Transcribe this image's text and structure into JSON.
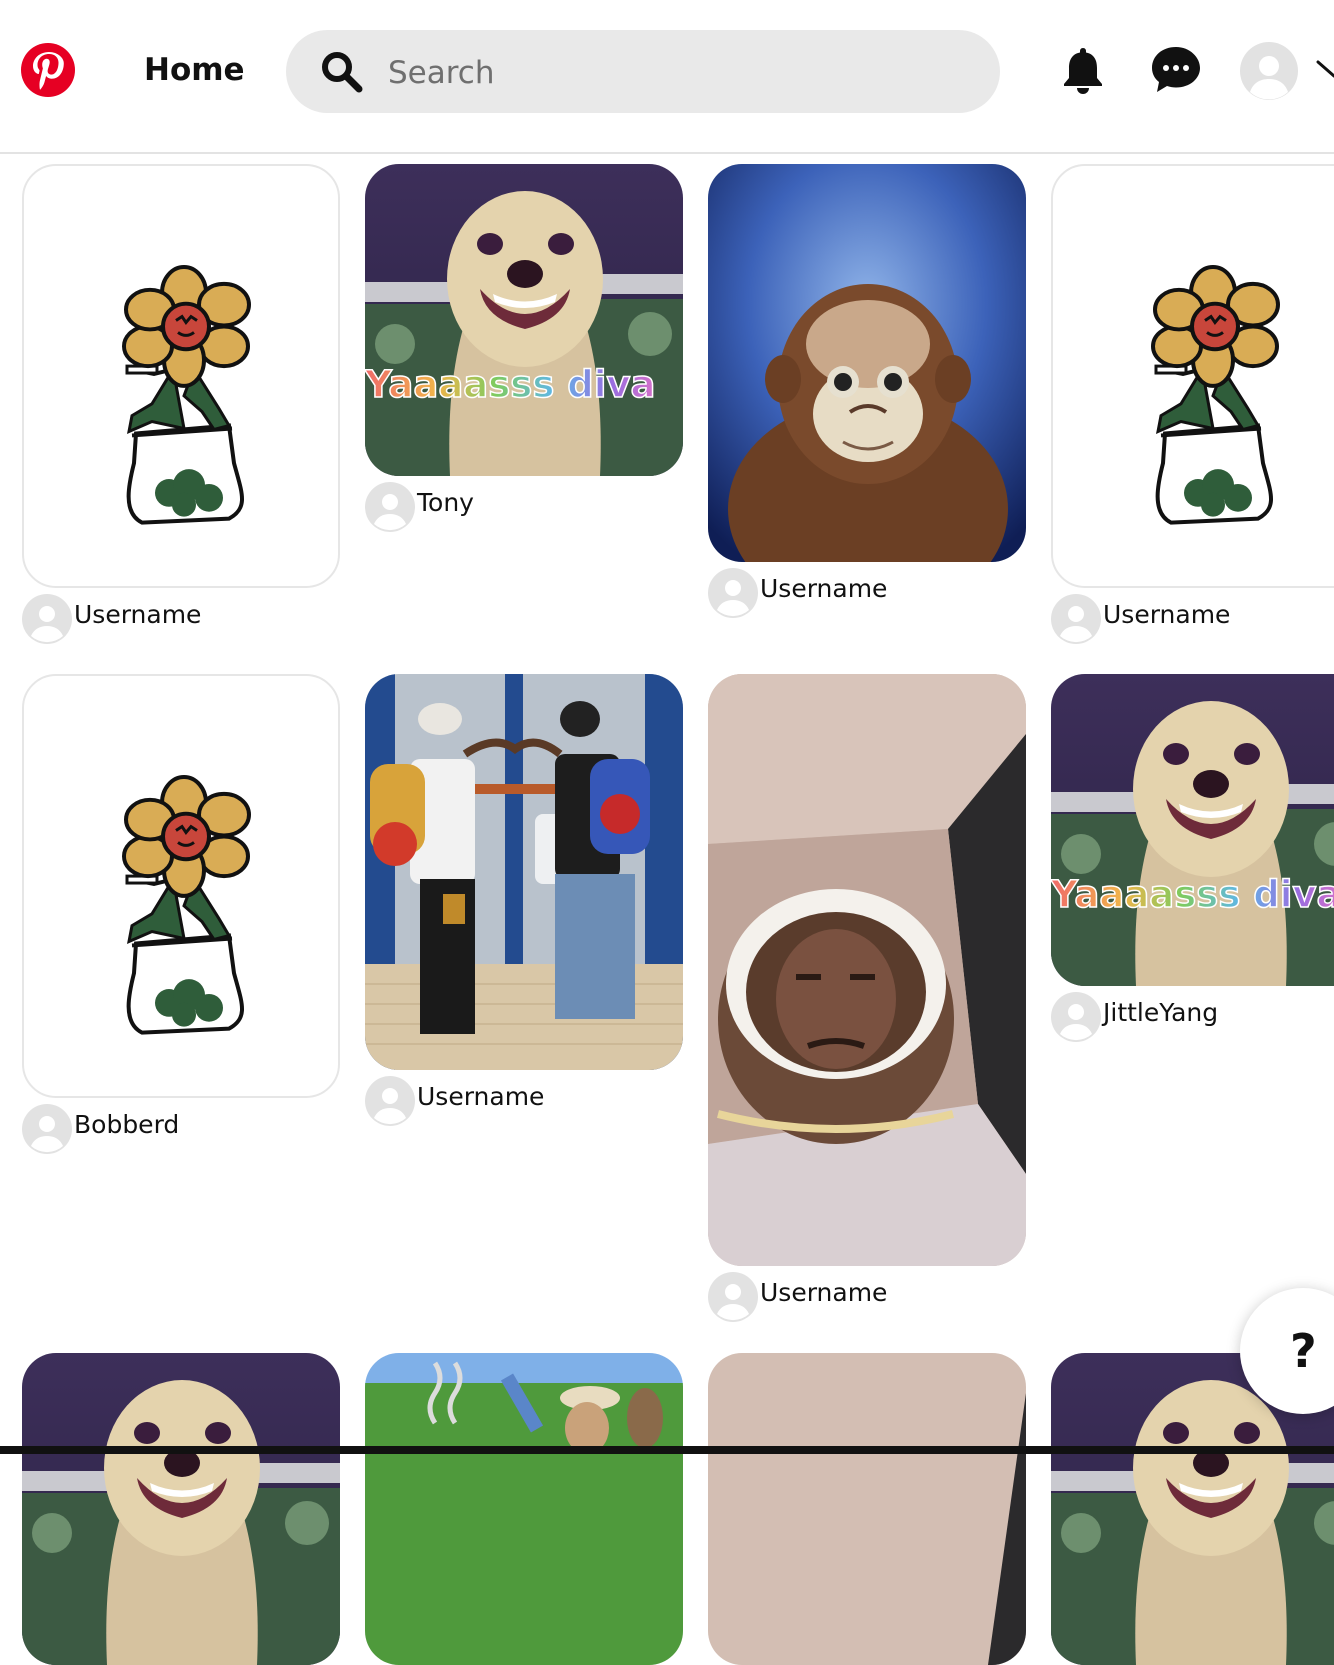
{
  "header": {
    "home_label": "Home",
    "search_placeholder": "Search",
    "icons": [
      "pinterest-logo",
      "search-icon",
      "bell-icon",
      "messages-icon",
      "avatar",
      "chevron-down-icon"
    ]
  },
  "colors": {
    "brand_red": "#e60023",
    "search_bg": "#e9e9e9"
  },
  "pins": [
    {
      "user": "Username",
      "image": "flower-bag-drawing"
    },
    {
      "user": "Tony",
      "image": "smiling-dog",
      "caption": "Yaaaasss diva"
    },
    {
      "user": "Username",
      "image": "plush-monkey"
    },
    {
      "user": "Username",
      "image": "flower-bag-drawing"
    },
    {
      "user": "Bobberd",
      "image": "flower-bag-drawing"
    },
    {
      "user": "Username",
      "image": "two-boys-backpacks"
    },
    {
      "user": "Username",
      "image": "face-cake-in-box"
    },
    {
      "user": "JittleYang",
      "image": "smiling-dog",
      "caption": "Yaaaasss diva"
    }
  ],
  "help_button": "?"
}
